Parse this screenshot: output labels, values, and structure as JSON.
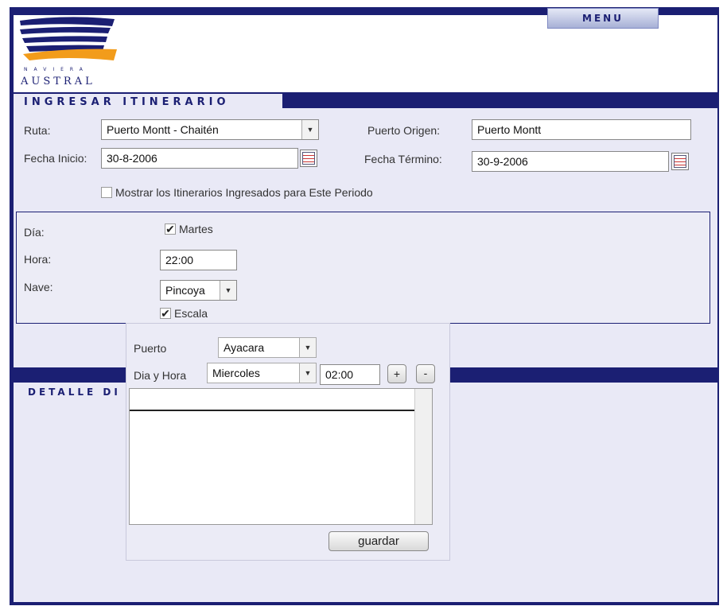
{
  "header": {
    "menu_label": "MENU",
    "logo_line1": "NAVIERA",
    "logo_line2": "AUSTRAL",
    "colors": {
      "navy": "#1b1f73",
      "orange": "#f29c1b",
      "panel": "#e9e9f6"
    }
  },
  "form": {
    "title": "INGRESAR ITINERARIO",
    "ruta_label": "Ruta:",
    "ruta_value": "Puerto Montt - Chaitén",
    "puerto_origen_label": "Puerto Origen:",
    "puerto_origen_value": "Puerto Montt",
    "fecha_inicio_label": "Fecha Inicio:",
    "fecha_inicio_value": "30-8-2006",
    "fecha_termino_label": "Fecha Término:",
    "fecha_termino_value": "30-9-2006",
    "mostrar_label": "Mostrar los Itinerarios Ingresados para Este Periodo",
    "mostrar_checked": false
  },
  "schedule": {
    "dia_label": "Día:",
    "dia_option": "Martes",
    "dia_checked": true,
    "hora_label": "Hora:",
    "hora_value": "22:00",
    "nave_label": "Nave:",
    "nave_value": "Pincoya",
    "escala_label": "Escala",
    "escala_checked": true
  },
  "escala_popup": {
    "puerto_label": "Puerto",
    "puerto_value": "Ayacara",
    "dia_hora_label": "Dia y Hora",
    "dia_value": "Miercoles",
    "hora_value": "02:00",
    "add_label": "+",
    "remove_label": "-",
    "save_label": "guardar"
  },
  "detalle": {
    "title": "DETALLE DI"
  },
  "icons": {
    "check": "✔",
    "arrow": "▼"
  }
}
